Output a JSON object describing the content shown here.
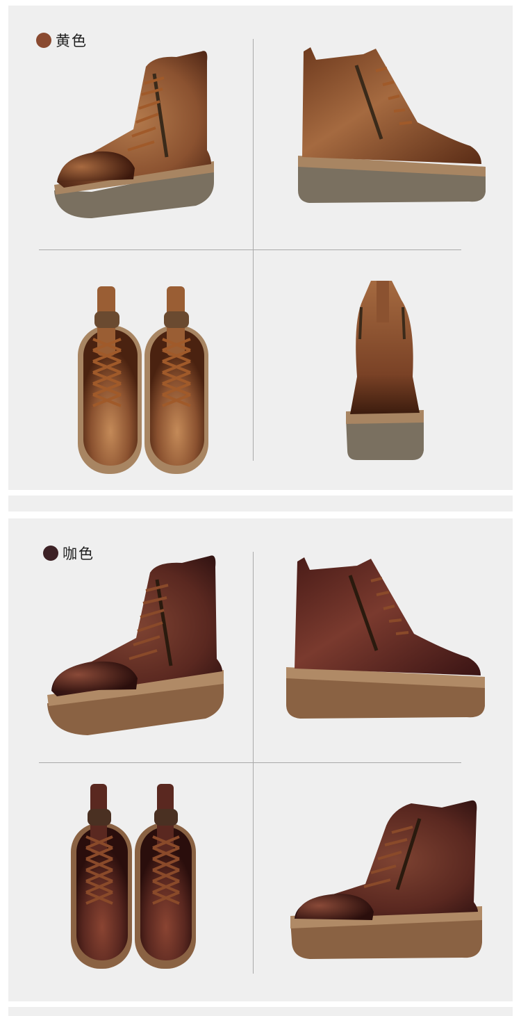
{
  "sections": [
    {
      "label": "黄色",
      "swatch": "#8a4a30"
    },
    {
      "label": "咖色",
      "swatch": "#3d2226"
    }
  ],
  "colors": {
    "yellow_upper": "#8b5230",
    "yellow_upper_light": "#b37a4c",
    "yellow_upper_dark": "#4c2414",
    "yellow_sole": "#7a7060",
    "yellow_welt": "#a88562",
    "coffee_upper": "#5a2820",
    "coffee_upper_light": "#7e4332",
    "coffee_upper_dark": "#2c1010",
    "coffee_sole": "#8a6243",
    "coffee_welt": "#b08a66",
    "lace": "#a05a2a"
  }
}
